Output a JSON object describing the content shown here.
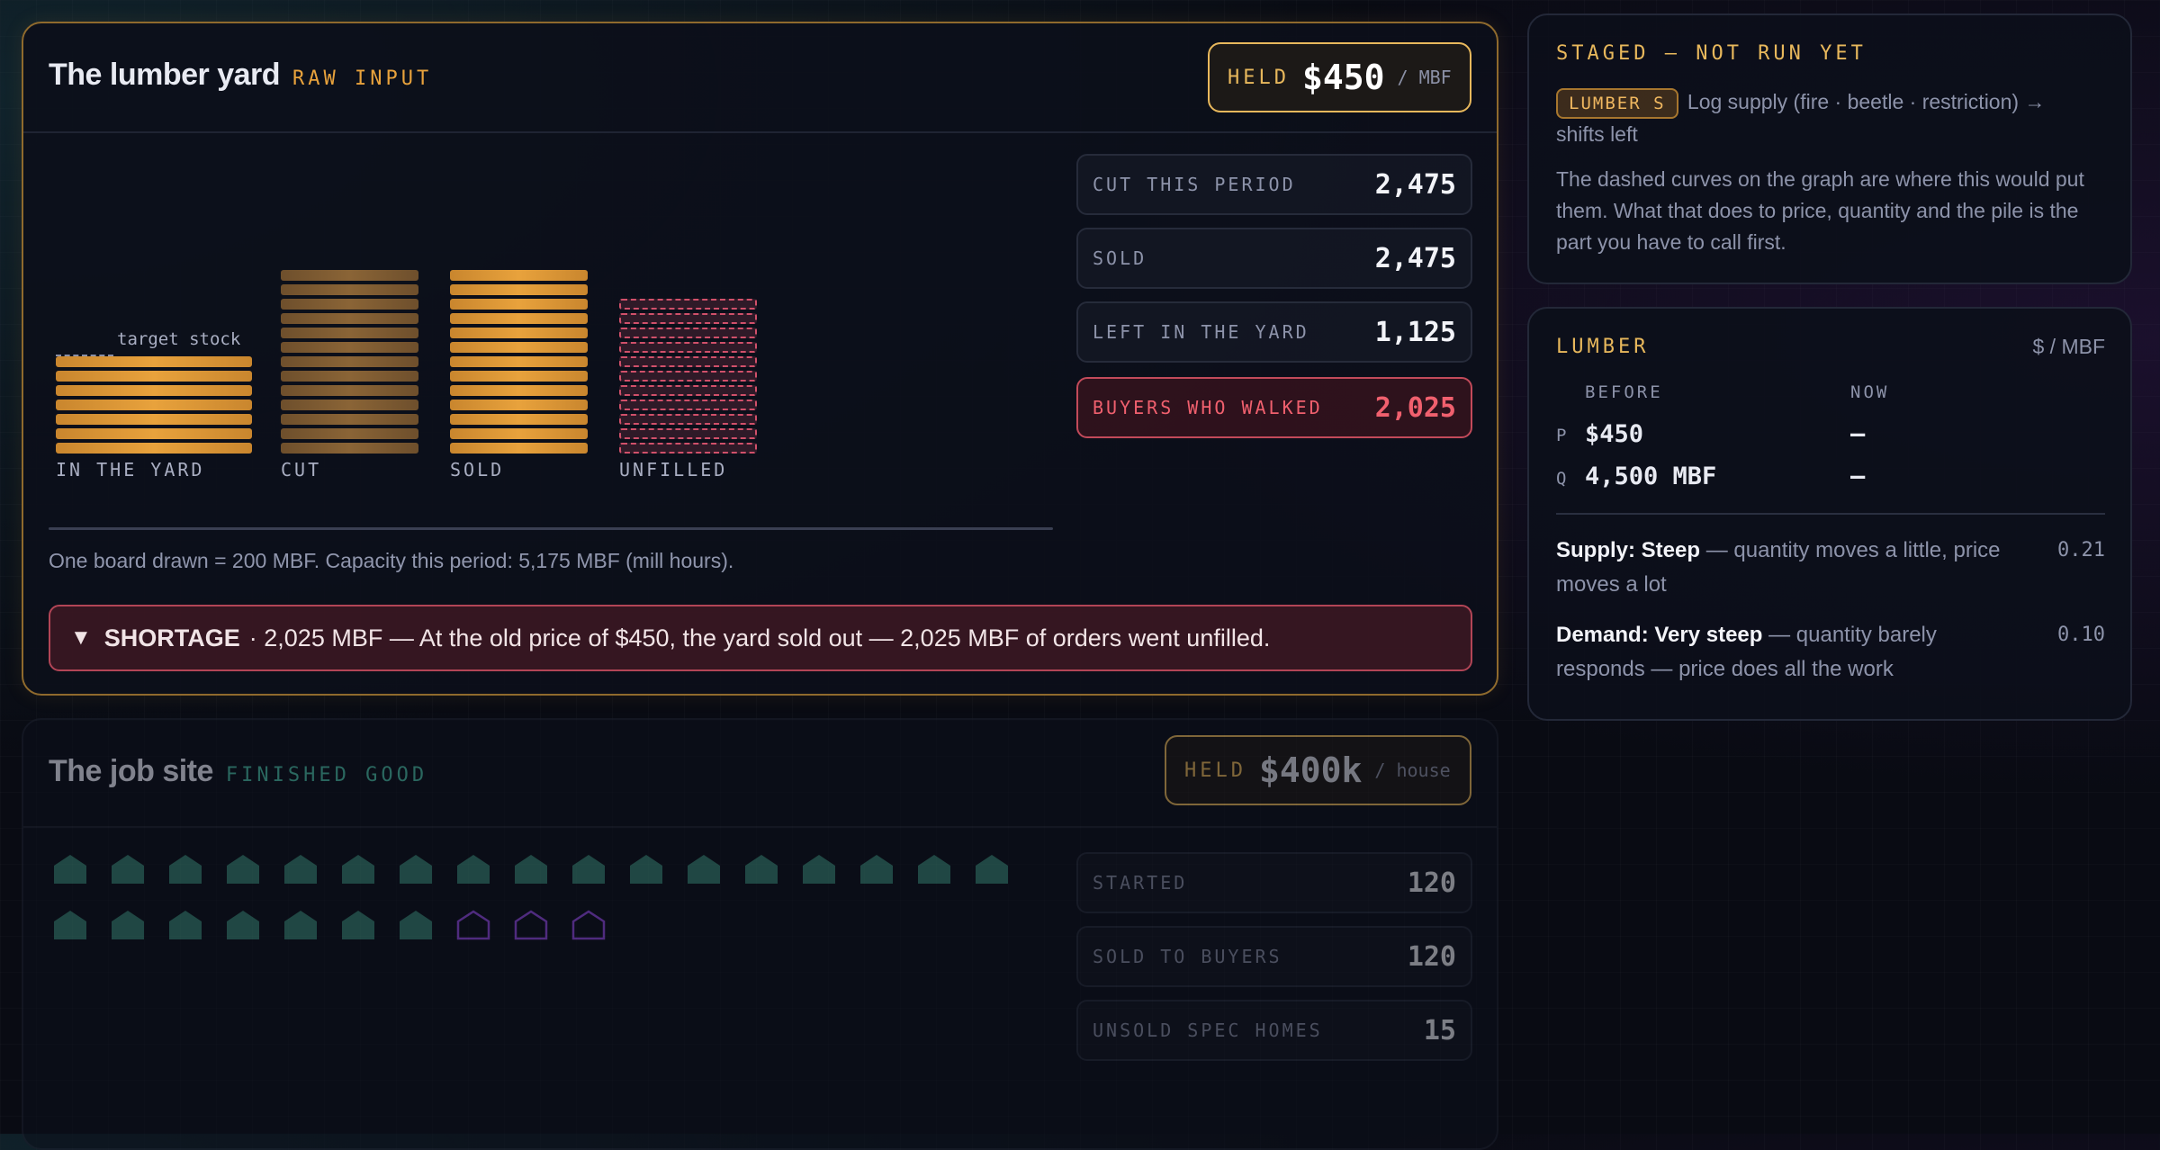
{
  "yard": {
    "title": "The lumber yard",
    "tag": "RAW INPUT",
    "held_label": "HELD",
    "held_value": "$450",
    "held_unit": "/ MBF",
    "stats": [
      {
        "label": "CUT THIS PERIOD",
        "value": "2,475"
      },
      {
        "label": "SOLD",
        "value": "2,475"
      },
      {
        "label": "LEFT IN THE YARD",
        "value": "1,125"
      },
      {
        "label": "BUYERS WHO WALKED",
        "value": "2,025"
      }
    ],
    "columns": {
      "in_yard": "IN THE YARD",
      "cut": "CUT",
      "sold": "SOLD",
      "unfilled": "UNFILLED"
    },
    "target_label": "target stock",
    "note": "One board drawn = 200 MBF. Capacity this period: 5,175 MBF (mill hours).",
    "shortage": {
      "icon": "▼",
      "label": "SHORTAGE",
      "text": "· 2,025 MBF — At the old price of $450, the yard sold out — 2,025 MBF of orders went unfilled."
    }
  },
  "site": {
    "title": "The job site",
    "tag": "FINISHED GOOD",
    "held_label": "HELD",
    "held_value": "$400k",
    "held_unit": "/ house",
    "stats": [
      {
        "label": "STARTED",
        "value": "120"
      },
      {
        "label": "SOLD TO BUYERS",
        "value": "120"
      },
      {
        "label": "UNSOLD SPEC HOMES",
        "value": "15"
      }
    ]
  },
  "staged": {
    "heading": "STAGED — NOT RUN YET",
    "chip": "LUMBER S",
    "shock": "Log supply (fire · beetle · restriction) → shifts left",
    "body": "The dashed curves on the graph are where this would put them. What that does to price, quantity and the pile is the part you have to call first."
  },
  "lumber": {
    "heading": "LUMBER",
    "unit": "$ / MBF",
    "col_before": "BEFORE",
    "col_now": "NOW",
    "rows": [
      {
        "key": "P",
        "before": "$450",
        "now": "—"
      },
      {
        "key": "Q",
        "before": "4,500 MBF",
        "now": "—"
      }
    ],
    "supply": {
      "label": "Supply: Steep",
      "desc": "— quantity moves a little, price moves a lot",
      "value": "0.21"
    },
    "demand": {
      "label": "Demand: Very steep",
      "desc": "— quantity barely responds — price does all the work",
      "value": "0.10"
    }
  },
  "colors": {
    "accent": "#e8b85c",
    "board_fresh": "#e8a23c",
    "board_cut": "#8a6436",
    "unfilled": "#d0506a",
    "house_built": "#2f6c62",
    "house_empty": "#7a3fc0"
  }
}
